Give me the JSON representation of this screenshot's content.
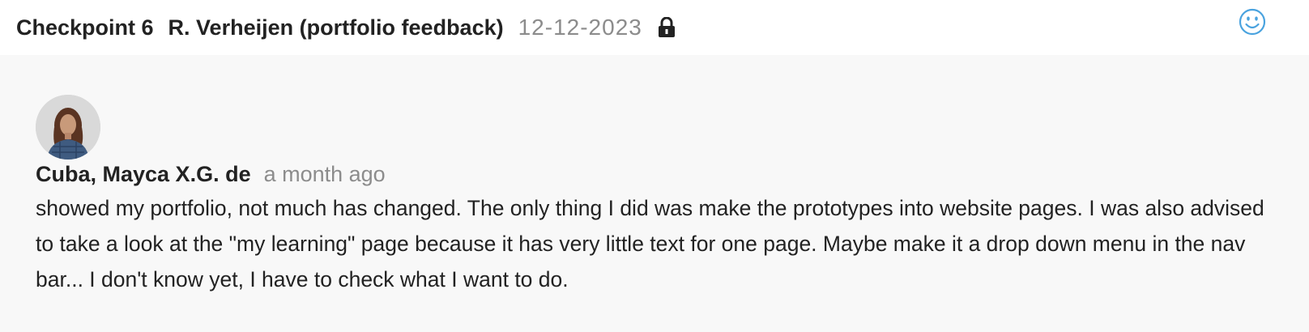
{
  "header": {
    "checkpoint": "Checkpoint 6",
    "teacher": "R. Verheijen (portfolio feedback)",
    "date": "12-12-2023",
    "lock_icon": "lock-icon",
    "feedback_icon": "smiley-icon",
    "accent_color": "#4aa3df"
  },
  "comment": {
    "avatar_icon": "avatar",
    "author": "Cuba, Mayca X.G. de",
    "time": "a month ago",
    "text": "showed my portfolio, not much has changed. The only thing I did was make the prototypes into website pages. I was also advised to take a look at the \"my learning\" page because it has very little text for one page. Maybe make it a drop down menu in the nav bar... I don't know yet, I have to check what I want to do."
  }
}
